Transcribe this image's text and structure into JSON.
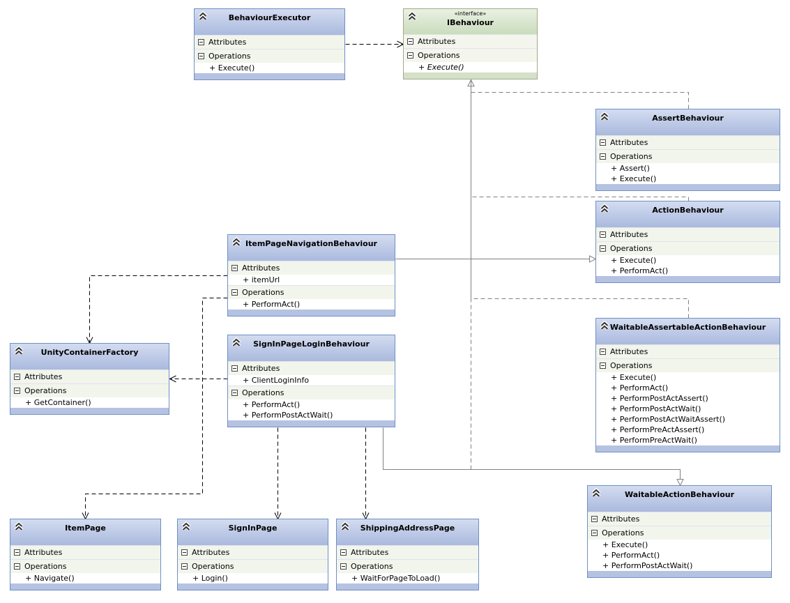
{
  "diagram": {
    "section_labels": {
      "attributes": "Attributes",
      "operations": "Operations"
    },
    "colors": {
      "class_border": "#6f8fc3",
      "class_header_top": "#d3dcf0",
      "class_header_bottom": "#aab9de",
      "interface_border": "#a3a985",
      "interface_header_top": "#eaf1e3",
      "interface_header_bottom": "#cadcbd",
      "dependency_line": "#000000",
      "inheritance_line": "#808080"
    },
    "classes": [
      {
        "id": "BehaviourExecutor",
        "name": "BehaviourExecutor",
        "kind": "class",
        "attributes": [],
        "operations": [
          "+ Execute()"
        ]
      },
      {
        "id": "IBehaviour",
        "name": "IBehaviour",
        "kind": "interface",
        "stereotype": "«interface»",
        "attributes": [],
        "operations": [
          "+ Execute()"
        ]
      },
      {
        "id": "AssertBehaviour",
        "name": "AssertBehaviour",
        "kind": "class",
        "attributes": [],
        "operations": [
          "+ Assert()",
          "+ Execute()"
        ]
      },
      {
        "id": "ActionBehaviour",
        "name": "ActionBehaviour",
        "kind": "class",
        "attributes": [],
        "operations": [
          "+ Execute()",
          "+ PerformAct()"
        ]
      },
      {
        "id": "ItemPageNavigationBehaviour",
        "name": "ItemPageNavigationBehaviour",
        "kind": "class",
        "attributes": [
          "+ itemUrl"
        ],
        "operations": [
          "+ PerformAct()"
        ]
      },
      {
        "id": "WaitableAssertableActionBehaviour",
        "name": "WaitableAssertableActionBehaviour",
        "kind": "class",
        "attributes": [],
        "operations": [
          "+ Execute()",
          "+ PerformAct()",
          "+ PerformPostActAssert()",
          "+ PerformPostActWait()",
          "+ PerformPostActWaitAssert()",
          "+ PerformPreActAssert()",
          "+ PerformPreActWait()"
        ]
      },
      {
        "id": "UnityContainerFactory",
        "name": "UnityContainerFactory",
        "kind": "class",
        "attributes": [],
        "operations": [
          "+ GetContainer()"
        ]
      },
      {
        "id": "SignInPageLoginBehaviour",
        "name": "SignInPageLoginBehaviour",
        "kind": "class",
        "attributes": [
          "+ ClientLoginInfo"
        ],
        "operations": [
          "+ PerformAct()",
          "+ PerformPostActWait()"
        ]
      },
      {
        "id": "WaitableActionBehaviour",
        "name": "WaitableActionBehaviour",
        "kind": "class",
        "attributes": [],
        "operations": [
          "+ Execute()",
          "+ PerformAct()",
          "+ PerformPostActWait()"
        ]
      },
      {
        "id": "ItemPage",
        "name": "ItemPage",
        "kind": "class",
        "attributes": [],
        "operations": [
          "+ Navigate()"
        ]
      },
      {
        "id": "SignInPage",
        "name": "SignInPage",
        "kind": "class",
        "attributes": [],
        "operations": [
          "+ Login()"
        ]
      },
      {
        "id": "ShippingAddressPage",
        "name": "ShippingAddressPage",
        "kind": "class",
        "attributes": [],
        "operations": [
          "+ WaitForPageToLoad()"
        ]
      }
    ],
    "relationships": [
      {
        "from": "BehaviourExecutor",
        "to": "IBehaviour",
        "type": "dependency"
      },
      {
        "from": "AssertBehaviour",
        "to": "IBehaviour",
        "type": "realization"
      },
      {
        "from": "ActionBehaviour",
        "to": "IBehaviour",
        "type": "realization"
      },
      {
        "from": "WaitableAssertableActionBehaviour",
        "to": "IBehaviour",
        "type": "realization"
      },
      {
        "from": "WaitableActionBehaviour",
        "to": "IBehaviour",
        "type": "realization"
      },
      {
        "from": "ItemPageNavigationBehaviour",
        "to": "ActionBehaviour",
        "type": "inheritance"
      },
      {
        "from": "SignInPageLoginBehaviour",
        "to": "WaitableActionBehaviour",
        "type": "inheritance"
      },
      {
        "from": "ItemPageNavigationBehaviour",
        "to": "UnityContainerFactory",
        "type": "dependency"
      },
      {
        "from": "ItemPageNavigationBehaviour",
        "to": "ItemPage",
        "type": "dependency"
      },
      {
        "from": "SignInPageLoginBehaviour",
        "to": "UnityContainerFactory",
        "type": "dependency"
      },
      {
        "from": "SignInPageLoginBehaviour",
        "to": "SignInPage",
        "type": "dependency"
      },
      {
        "from": "SignInPageLoginBehaviour",
        "to": "ShippingAddressPage",
        "type": "dependency"
      }
    ]
  }
}
